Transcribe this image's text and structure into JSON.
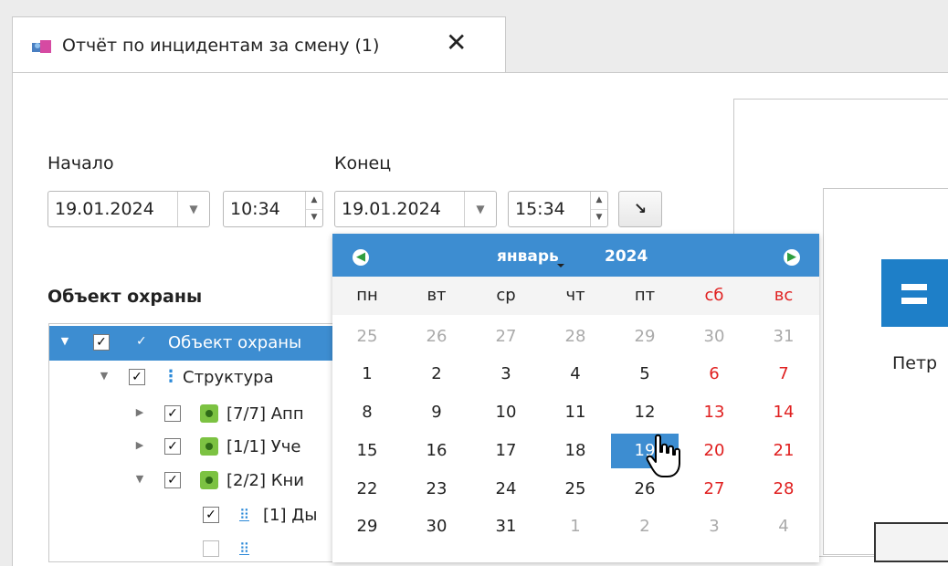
{
  "tab": {
    "title": "Отчёт по инцидентам за смену (1)",
    "close_icon": "close-icon",
    "icon": "report-icon"
  },
  "form": {
    "start": {
      "label": "Начало",
      "date": "19.01.2024",
      "time": "10:34"
    },
    "end": {
      "label": "Конец",
      "date": "19.01.2024",
      "time": "15:34"
    },
    "apply_icon": "arrow-down-right-icon"
  },
  "tree": {
    "title": "Объект охраны",
    "rows": [
      {
        "label": "Объект охраны",
        "icon": "check-icon",
        "level": 0,
        "expanded": true,
        "checked": true,
        "selected": true
      },
      {
        "label": "Структура",
        "icon": "structure-icon",
        "level": 1,
        "expanded": true,
        "checked": true
      },
      {
        "label": "[7/7] Апп",
        "icon": "node-icon",
        "level": 2,
        "expanded": false,
        "checked": true
      },
      {
        "label": "[1/1] Уче",
        "icon": "node-icon",
        "level": 2,
        "expanded": false,
        "checked": true
      },
      {
        "label": "[2/2] Кни",
        "icon": "node-icon",
        "level": 2,
        "expanded": true,
        "checked": true
      },
      {
        "label": "[1] Ды",
        "icon": "camera-group-icon",
        "level": 3,
        "checked": true
      },
      {
        "label": "",
        "icon": "camera-group-icon",
        "level": 3,
        "checked": false
      }
    ]
  },
  "calendar": {
    "month": "январь",
    "year": "2024",
    "weekdays": [
      "пн",
      "вт",
      "ср",
      "чт",
      "пт",
      "сб",
      "вс"
    ],
    "weeks": [
      [
        "25",
        "26",
        "27",
        "28",
        "29",
        "30",
        "31"
      ],
      [
        "1",
        "2",
        "3",
        "4",
        "5",
        "6",
        "7"
      ],
      [
        "8",
        "9",
        "10",
        "11",
        "12",
        "13",
        "14"
      ],
      [
        "15",
        "16",
        "17",
        "18",
        "19",
        "20",
        "21"
      ],
      [
        "22",
        "23",
        "24",
        "25",
        "26",
        "27",
        "28"
      ],
      [
        "29",
        "30",
        "31",
        "1",
        "2",
        "3",
        "4"
      ]
    ],
    "selected": "19",
    "colors": {
      "header": "#3d8dd1",
      "weekend": "#e02020",
      "other_month": "#aaaaaa"
    }
  },
  "preview": {
    "text": "Петр"
  }
}
